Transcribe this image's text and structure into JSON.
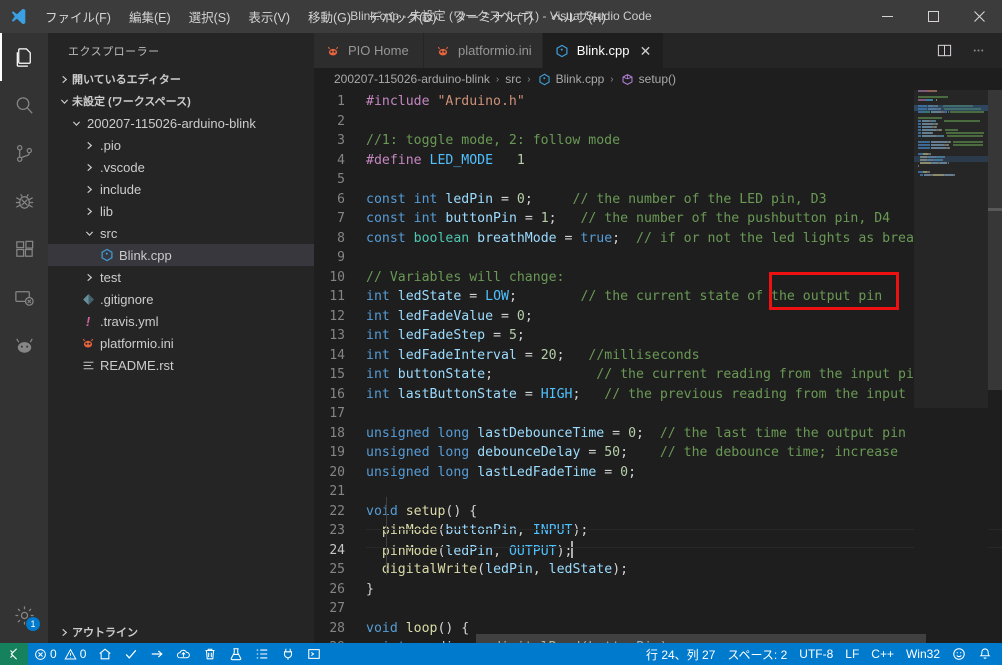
{
  "window": {
    "title": "Blink.cpp - 未設定 (ワークスペース) - Visual Studio Code",
    "minimize": "—",
    "maximize": "☐",
    "close": "✕"
  },
  "menubar": {
    "items": [
      {
        "label": "ファイル(F)",
        "name": "menu-file"
      },
      {
        "label": "編集(E)",
        "name": "menu-edit"
      },
      {
        "label": "選択(S)",
        "name": "menu-selection"
      },
      {
        "label": "表示(V)",
        "name": "menu-view"
      },
      {
        "label": "移動(G)",
        "name": "menu-go"
      },
      {
        "label": "デバッグ(D)",
        "name": "menu-debug"
      },
      {
        "label": "ターミナル(T)",
        "name": "menu-terminal"
      },
      {
        "label": "ヘルプ(H)",
        "name": "menu-help"
      }
    ]
  },
  "activitybar": {
    "items": [
      {
        "icon": "files-icon",
        "label": "エクスプローラー",
        "active": true
      },
      {
        "icon": "search-icon",
        "label": "検索",
        "active": false
      },
      {
        "icon": "source-control-icon",
        "label": "ソース管理",
        "active": false
      },
      {
        "icon": "debug-icon",
        "label": "デバッグ",
        "active": false
      },
      {
        "icon": "extensions-icon",
        "label": "拡張機能",
        "active": false
      },
      {
        "icon": "remote-explorer-icon",
        "label": "リモートエクスプローラー",
        "active": false
      },
      {
        "icon": "platformio-ant-icon",
        "label": "PlatformIO",
        "active": false
      }
    ],
    "settings": {
      "icon": "gear-icon",
      "badge": "1"
    }
  },
  "sidebar": {
    "title": "エクスプローラー",
    "sections": [
      {
        "label": "開いているエディター",
        "expanded": false
      },
      {
        "label": "未設定 (ワークスペース)",
        "expanded": true
      }
    ],
    "tree": [
      {
        "label": "200207-115026-arduino-blink",
        "depth": 0,
        "type": "folder",
        "expanded": true,
        "icon": "folder-icon",
        "selected": false
      },
      {
        "label": ".pio",
        "depth": 1,
        "type": "folder",
        "expanded": false,
        "icon": "folder-icon",
        "selected": false
      },
      {
        "label": ".vscode",
        "depth": 1,
        "type": "folder",
        "expanded": false,
        "icon": "folder-icon",
        "selected": false
      },
      {
        "label": "include",
        "depth": 1,
        "type": "folder",
        "expanded": false,
        "icon": "folder-icon",
        "selected": false
      },
      {
        "label": "lib",
        "depth": 1,
        "type": "folder",
        "expanded": false,
        "icon": "folder-icon",
        "selected": false
      },
      {
        "label": "src",
        "depth": 1,
        "type": "folder",
        "expanded": true,
        "icon": "folder-icon",
        "selected": false
      },
      {
        "label": "Blink.cpp",
        "depth": 2,
        "type": "file",
        "icon": "cpp-file-icon",
        "selected": true
      },
      {
        "label": "test",
        "depth": 1,
        "type": "folder",
        "expanded": false,
        "icon": "folder-icon",
        "selected": false
      },
      {
        "label": ".gitignore",
        "depth": 1,
        "type": "file",
        "icon": "git-file-icon",
        "selected": false
      },
      {
        "label": ".travis.yml",
        "depth": 1,
        "type": "file",
        "icon": "travis-file-icon",
        "selected": false
      },
      {
        "label": "platformio.ini",
        "depth": 1,
        "type": "file",
        "icon": "platformio-ant-icon",
        "selected": false
      },
      {
        "label": "README.rst",
        "depth": 1,
        "type": "file",
        "icon": "rst-file-icon",
        "selected": false
      }
    ],
    "outline": {
      "label": "アウトライン",
      "expanded": false
    }
  },
  "tabs": [
    {
      "label": "PIO Home",
      "icon": "platformio-ant-icon",
      "active": false,
      "closable": false
    },
    {
      "label": "platformio.ini",
      "icon": "platformio-ant-icon",
      "active": false,
      "closable": false
    },
    {
      "label": "Blink.cpp",
      "icon": "cpp-file-icon",
      "active": true,
      "closable": true,
      "close": "✕"
    }
  ],
  "editor_actions": [
    {
      "name": "split-editor-icon",
      "label": "エディターを分割"
    },
    {
      "name": "more-actions-icon",
      "label": "その他のアクション..."
    }
  ],
  "breadcrumbs": [
    {
      "label": "200207-115026-arduino-blink",
      "icon": ""
    },
    {
      "label": "src",
      "icon": ""
    },
    {
      "label": "Blink.cpp",
      "icon": "cpp-file-icon"
    },
    {
      "label": "setup()",
      "icon": "symbol-method-icon"
    }
  ],
  "breadcrumb_separator": "›",
  "code": {
    "language": "C++",
    "cursor_line": 24,
    "lines": [
      {
        "n": "1",
        "tokens": [
          {
            "t": "#include ",
            "c": "kp"
          },
          {
            "t": "\"Arduino.h\"",
            "c": "st"
          }
        ]
      },
      {
        "n": "2",
        "tokens": []
      },
      {
        "n": "3",
        "tokens": [
          {
            "t": "//1: toggle mode, 2: follow mode",
            "c": "cm"
          }
        ]
      },
      {
        "n": "4",
        "tokens": [
          {
            "t": "#define ",
            "c": "kp"
          },
          {
            "t": "LED_MODE",
            "c": "mc"
          },
          {
            "t": "   ",
            "c": "pn"
          },
          {
            "t": "1",
            "c": "num"
          }
        ]
      },
      {
        "n": "5",
        "tokens": []
      },
      {
        "n": "6",
        "tokens": [
          {
            "t": "const ",
            "c": "k"
          },
          {
            "t": "int",
            "c": "k"
          },
          {
            "t": " ",
            "c": "pn"
          },
          {
            "t": "ledPin",
            "c": "id"
          },
          {
            "t": " = ",
            "c": "pn"
          },
          {
            "t": "0",
            "c": "num"
          },
          {
            "t": ";",
            "c": "pn"
          },
          {
            "t": "     ",
            "c": "pn"
          },
          {
            "t": "// the number of the LED pin, D3",
            "c": "cm"
          }
        ]
      },
      {
        "n": "7",
        "tokens": [
          {
            "t": "const ",
            "c": "k"
          },
          {
            "t": "int",
            "c": "k"
          },
          {
            "t": " ",
            "c": "pn"
          },
          {
            "t": "buttonPin",
            "c": "id"
          },
          {
            "t": " = ",
            "c": "pn"
          },
          {
            "t": "1",
            "c": "num"
          },
          {
            "t": ";",
            "c": "pn"
          },
          {
            "t": "   ",
            "c": "pn"
          },
          {
            "t": "// the number of the pushbutton pin, D4",
            "c": "cm"
          }
        ]
      },
      {
        "n": "8",
        "tokens": [
          {
            "t": "const ",
            "c": "k"
          },
          {
            "t": "boolean",
            "c": "ty"
          },
          {
            "t": " ",
            "c": "pn"
          },
          {
            "t": "breathMode",
            "c": "id"
          },
          {
            "t": " = ",
            "c": "pn"
          },
          {
            "t": "true",
            "c": "k"
          },
          {
            "t": ";",
            "c": "pn"
          },
          {
            "t": "  ",
            "c": "pn"
          },
          {
            "t": "// if or not the led lights as brea",
            "c": "cm"
          }
        ]
      },
      {
        "n": "9",
        "tokens": []
      },
      {
        "n": "10",
        "tokens": [
          {
            "t": "// Variables will change:",
            "c": "cm"
          }
        ]
      },
      {
        "n": "11",
        "tokens": [
          {
            "t": "int",
            "c": "k"
          },
          {
            "t": " ",
            "c": "pn"
          },
          {
            "t": "ledState",
            "c": "id"
          },
          {
            "t": " = ",
            "c": "pn"
          },
          {
            "t": "LOW",
            "c": "mc"
          },
          {
            "t": ";",
            "c": "pn"
          },
          {
            "t": "        ",
            "c": "pn"
          },
          {
            "t": "// the current state of the output pin",
            "c": "cm"
          }
        ]
      },
      {
        "n": "12",
        "tokens": [
          {
            "t": "int",
            "c": "k"
          },
          {
            "t": " ",
            "c": "pn"
          },
          {
            "t": "ledFadeValue",
            "c": "id"
          },
          {
            "t": " = ",
            "c": "pn"
          },
          {
            "t": "0",
            "c": "num"
          },
          {
            "t": ";",
            "c": "pn"
          }
        ]
      },
      {
        "n": "13",
        "tokens": [
          {
            "t": "int",
            "c": "k"
          },
          {
            "t": " ",
            "c": "pn"
          },
          {
            "t": "ledFadeStep",
            "c": "id"
          },
          {
            "t": " = ",
            "c": "pn"
          },
          {
            "t": "5",
            "c": "num"
          },
          {
            "t": ";",
            "c": "pn"
          }
        ]
      },
      {
        "n": "14",
        "tokens": [
          {
            "t": "int",
            "c": "k"
          },
          {
            "t": " ",
            "c": "pn"
          },
          {
            "t": "ledFadeInterval",
            "c": "id"
          },
          {
            "t": " = ",
            "c": "pn"
          },
          {
            "t": "20",
            "c": "num"
          },
          {
            "t": ";",
            "c": "pn"
          },
          {
            "t": "   ",
            "c": "pn"
          },
          {
            "t": "//milliseconds",
            "c": "cm"
          }
        ]
      },
      {
        "n": "15",
        "tokens": [
          {
            "t": "int",
            "c": "k"
          },
          {
            "t": " ",
            "c": "pn"
          },
          {
            "t": "buttonState",
            "c": "id"
          },
          {
            "t": ";",
            "c": "pn"
          },
          {
            "t": "             ",
            "c": "pn"
          },
          {
            "t": "// the current reading from the input pi",
            "c": "cm"
          }
        ]
      },
      {
        "n": "16",
        "tokens": [
          {
            "t": "int",
            "c": "k"
          },
          {
            "t": " ",
            "c": "pn"
          },
          {
            "t": "lastButtonState",
            "c": "id"
          },
          {
            "t": " = ",
            "c": "pn"
          },
          {
            "t": "HIGH",
            "c": "mc"
          },
          {
            "t": ";",
            "c": "pn"
          },
          {
            "t": "   ",
            "c": "pn"
          },
          {
            "t": "// the previous reading from the input",
            "c": "cm"
          }
        ]
      },
      {
        "n": "17",
        "tokens": []
      },
      {
        "n": "18",
        "tokens": [
          {
            "t": "unsigned ",
            "c": "k"
          },
          {
            "t": "long",
            "c": "k"
          },
          {
            "t": " ",
            "c": "pn"
          },
          {
            "t": "lastDebounceTime",
            "c": "id"
          },
          {
            "t": " = ",
            "c": "pn"
          },
          {
            "t": "0",
            "c": "num"
          },
          {
            "t": ";",
            "c": "pn"
          },
          {
            "t": "  ",
            "c": "pn"
          },
          {
            "t": "// the last time the output pin",
            "c": "cm"
          }
        ]
      },
      {
        "n": "19",
        "tokens": [
          {
            "t": "unsigned ",
            "c": "k"
          },
          {
            "t": "long",
            "c": "k"
          },
          {
            "t": " ",
            "c": "pn"
          },
          {
            "t": "debounceDelay",
            "c": "id"
          },
          {
            "t": " = ",
            "c": "pn"
          },
          {
            "t": "50",
            "c": "num"
          },
          {
            "t": ";",
            "c": "pn"
          },
          {
            "t": "    ",
            "c": "pn"
          },
          {
            "t": "// the debounce time; increase ",
            "c": "cm"
          }
        ]
      },
      {
        "n": "20",
        "tokens": [
          {
            "t": "unsigned ",
            "c": "k"
          },
          {
            "t": "long",
            "c": "k"
          },
          {
            "t": " ",
            "c": "pn"
          },
          {
            "t": "lastLedFadeTime",
            "c": "id"
          },
          {
            "t": " = ",
            "c": "pn"
          },
          {
            "t": "0",
            "c": "num"
          },
          {
            "t": ";",
            "c": "pn"
          }
        ]
      },
      {
        "n": "21",
        "tokens": []
      },
      {
        "n": "22",
        "tokens": [
          {
            "t": "void ",
            "c": "k"
          },
          {
            "t": "setup",
            "c": "fn"
          },
          {
            "t": "() {",
            "c": "pn"
          }
        ]
      },
      {
        "n": "23",
        "tokens": [
          {
            "t": "  ",
            "c": "pn"
          },
          {
            "t": "pinMode",
            "c": "fn"
          },
          {
            "t": "(",
            "c": "pn"
          },
          {
            "t": "buttonPin",
            "c": "id"
          },
          {
            "t": ", ",
            "c": "pn"
          },
          {
            "t": "INPUT",
            "c": "mc"
          },
          {
            "t": ");",
            "c": "pn"
          }
        ]
      },
      {
        "n": "24",
        "tokens": [
          {
            "t": "  ",
            "c": "pn"
          },
          {
            "t": "pinMode",
            "c": "fn"
          },
          {
            "t": "(",
            "c": "pn"
          },
          {
            "t": "ledPin",
            "c": "id"
          },
          {
            "t": ", ",
            "c": "pn"
          },
          {
            "t": "OUTPUT",
            "c": "mc"
          },
          {
            "t": ");",
            "c": "pn"
          }
        ]
      },
      {
        "n": "25",
        "tokens": [
          {
            "t": "  ",
            "c": "pn"
          },
          {
            "t": "digitalWrite",
            "c": "fn"
          },
          {
            "t": "(",
            "c": "pn"
          },
          {
            "t": "ledPin",
            "c": "id"
          },
          {
            "t": ", ",
            "c": "pn"
          },
          {
            "t": "ledState",
            "c": "id"
          },
          {
            "t": ");",
            "c": "pn"
          }
        ]
      },
      {
        "n": "26",
        "tokens": [
          {
            "t": "}",
            "c": "pn"
          }
        ]
      },
      {
        "n": "27",
        "tokens": []
      },
      {
        "n": "28",
        "tokens": [
          {
            "t": "void ",
            "c": "k"
          },
          {
            "t": "loop",
            "c": "fn"
          },
          {
            "t": "() {",
            "c": "pn"
          }
        ]
      },
      {
        "n": "29",
        "tokens": [
          {
            "t": "  ",
            "c": "pn"
          },
          {
            "t": "int",
            "c": "k"
          },
          {
            "t": " ",
            "c": "pn"
          },
          {
            "t": "reading",
            "c": "id"
          },
          {
            "t": " = ",
            "c": "pn"
          },
          {
            "t": "digitalRead",
            "c": "fn"
          },
          {
            "t": "(",
            "c": "pn"
          },
          {
            "t": "buttonPin",
            "c": "id"
          },
          {
            "t": ");",
            "c": "pn"
          }
        ]
      }
    ],
    "annotation": {
      "color": "#ee1111",
      "shape": "rectangle",
      "covers_lines": [
        6,
        7
      ]
    }
  },
  "statusbar": {
    "remote_icon": "remote-window-icon",
    "left": [
      {
        "name": "error-count",
        "icon": "error-icon",
        "text": "0"
      },
      {
        "name": "warning-count",
        "icon": "warning-icon",
        "text": "0"
      },
      {
        "name": "pio-home",
        "icon": "home-icon",
        "text": ""
      },
      {
        "name": "pio-build",
        "icon": "check-icon",
        "text": ""
      },
      {
        "name": "pio-upload",
        "icon": "arrow-right-icon",
        "text": ""
      },
      {
        "name": "pio-upload-ota",
        "icon": "cloud-upload-icon",
        "text": ""
      },
      {
        "name": "pio-clean",
        "icon": "trash-icon",
        "text": ""
      },
      {
        "name": "pio-test",
        "icon": "beaker-icon",
        "text": ""
      },
      {
        "name": "pio-tasks",
        "icon": "list-icon",
        "text": ""
      },
      {
        "name": "pio-serial-monitor",
        "icon": "plug-icon",
        "text": ""
      },
      {
        "name": "pio-terminal",
        "icon": "terminal-icon",
        "text": ""
      }
    ],
    "right": [
      {
        "name": "cursor-position",
        "text": "行 24、列 27"
      },
      {
        "name": "indentation",
        "text": "スペース: 2"
      },
      {
        "name": "encoding",
        "text": "UTF-8"
      },
      {
        "name": "eol",
        "text": "LF"
      },
      {
        "name": "language-mode",
        "text": "C++"
      },
      {
        "name": "platform-target",
        "text": "Win32"
      },
      {
        "name": "feedback-smiley",
        "text": "☺"
      },
      {
        "name": "notifications-bell",
        "text": "🔔"
      }
    ]
  },
  "colors": {
    "titlebar_bg": "#3c3c3c",
    "activitybar_bg": "#333333",
    "sidebar_bg": "#252526",
    "editor_bg": "#1e1e1e",
    "statusbar_bg": "#007acc",
    "remote_bg": "#16825d",
    "accent": "#007acc",
    "annotation_red": "#ee1111",
    "selected_row": "#37373d"
  }
}
